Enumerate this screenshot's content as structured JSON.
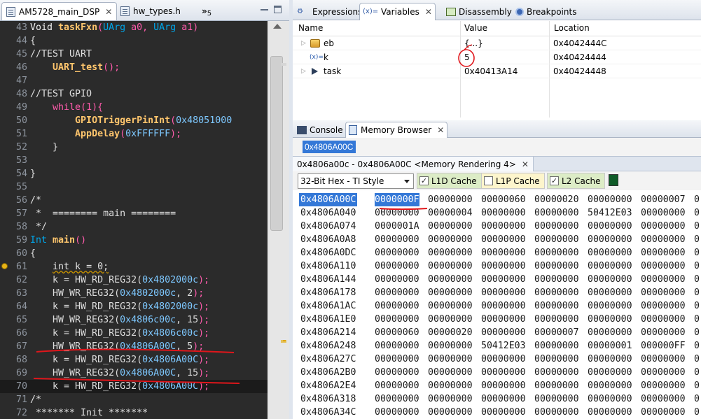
{
  "editor": {
    "tabs": [
      {
        "label": "AM5728_main_DSP",
        "active": true
      },
      {
        "label": "hw_types.h",
        "active": false
      }
    ],
    "overflow_count": "5",
    "lines": [
      {
        "no": "43",
        "segs": [
          [
            "kw2",
            "Void "
          ],
          [
            "fn",
            "taskFxn"
          ],
          [
            "punc",
            "("
          ],
          [
            "kw",
            "UArg "
          ],
          [
            "punc",
            "a0, "
          ],
          [
            "kw",
            "UArg "
          ],
          [
            "punc",
            "a1)"
          ]
        ]
      },
      {
        "no": "44",
        "segs": [
          [
            "plain",
            "{"
          ]
        ]
      },
      {
        "no": "45",
        "segs": [
          [
            "cm",
            "//TEST UART"
          ]
        ]
      },
      {
        "no": "46",
        "segs": [
          [
            "plain",
            "    "
          ],
          [
            "fn",
            "UART_test"
          ],
          [
            "punc",
            "();"
          ]
        ]
      },
      {
        "no": "47",
        "segs": []
      },
      {
        "no": "48",
        "segs": [
          [
            "cm",
            "//TEST GPIO"
          ]
        ]
      },
      {
        "no": "49",
        "segs": [
          [
            "plain",
            "    "
          ],
          [
            "mag",
            "while"
          ],
          [
            "punc",
            "(1){"
          ]
        ]
      },
      {
        "no": "50",
        "segs": [
          [
            "plain",
            "        "
          ],
          [
            "fn",
            "GPIOTriggerPinInt"
          ],
          [
            "punc",
            "("
          ],
          [
            "hex",
            "0x48051000"
          ]
        ]
      },
      {
        "no": "51",
        "segs": [
          [
            "plain",
            "        "
          ],
          [
            "fn",
            "AppDelay"
          ],
          [
            "punc",
            "("
          ],
          [
            "hex",
            "0xFFFFFF"
          ],
          [
            "punc",
            ");"
          ]
        ]
      },
      {
        "no": "52",
        "segs": [
          [
            "plain",
            "    }"
          ]
        ]
      },
      {
        "no": "53",
        "segs": []
      },
      {
        "no": "54",
        "segs": [
          [
            "plain",
            "}"
          ]
        ]
      },
      {
        "no": "55",
        "segs": []
      },
      {
        "no": "56",
        "segs": [
          [
            "cm",
            "/*"
          ]
        ]
      },
      {
        "no": "57",
        "segs": [
          [
            "cm",
            " *  ======== main ========"
          ]
        ]
      },
      {
        "no": "58",
        "segs": [
          [
            "cm",
            " */"
          ]
        ]
      },
      {
        "no": "59",
        "segs": [
          [
            "kw",
            "Int "
          ],
          [
            "fn",
            "main"
          ],
          [
            "punc",
            "()"
          ]
        ]
      },
      {
        "no": "60",
        "segs": [
          [
            "plain",
            "{"
          ]
        ]
      },
      {
        "no": "61",
        "segs": [
          [
            "plain",
            "    "
          ],
          [
            "under",
            "int k = 0;"
          ]
        ]
      },
      {
        "no": "62",
        "segs": [
          [
            "plain",
            "    k = HW_RD_REG32("
          ],
          [
            "hex",
            "0x4802000c"
          ],
          [
            "punc",
            ");"
          ]
        ]
      },
      {
        "no": "63",
        "segs": [
          [
            "plain",
            "    HW_WR_REG32("
          ],
          [
            "hex",
            "0x4802000c"
          ],
          [
            "plain",
            ", 2"
          ],
          [
            "punc",
            ");"
          ]
        ]
      },
      {
        "no": "64",
        "segs": [
          [
            "plain",
            "    k = HW_RD_REG32("
          ],
          [
            "hex",
            "0x4802000c"
          ],
          [
            "punc",
            ");"
          ]
        ]
      },
      {
        "no": "65",
        "segs": [
          [
            "plain",
            "    HW_WR_REG32("
          ],
          [
            "hex",
            "0x4806c00c"
          ],
          [
            "plain",
            ", 15"
          ],
          [
            "punc",
            ");"
          ]
        ]
      },
      {
        "no": "66",
        "segs": [
          [
            "plain",
            "    k = HW_RD_REG32("
          ],
          [
            "hex",
            "0x4806c00c"
          ],
          [
            "punc",
            ");"
          ]
        ]
      },
      {
        "no": "67",
        "segs": [
          [
            "plain",
            "    HW_WR_REG32("
          ],
          [
            "hex",
            "0x4806A00C"
          ],
          [
            "plain",
            ", 5"
          ],
          [
            "punc",
            ");"
          ]
        ]
      },
      {
        "no": "68",
        "segs": [
          [
            "plain",
            "    k = HW_RD_REG32("
          ],
          [
            "hex",
            "0x4806A00C"
          ],
          [
            "punc",
            ");"
          ]
        ]
      },
      {
        "no": "69",
        "segs": [
          [
            "plain",
            "    HW_WR_REG32("
          ],
          [
            "hex",
            "0x4806A00C"
          ],
          [
            "plain",
            ", 15"
          ],
          [
            "punc",
            ");"
          ]
        ]
      },
      {
        "no": "70",
        "segs": [
          [
            "plain",
            "    k = HW_RD_REG32("
          ],
          [
            "hex",
            "0x4806A00C"
          ],
          [
            "punc",
            ");"
          ]
        ]
      },
      {
        "no": "71",
        "segs": [
          [
            "cm",
            "/*"
          ]
        ]
      },
      {
        "no": "72",
        "segs": [
          [
            "cm",
            " ******* Init *******"
          ]
        ]
      }
    ]
  },
  "variables_view": {
    "tabs": [
      "Expressions",
      "Variables",
      "Disassembly",
      "Breakpoints"
    ],
    "active_tab": "Variables",
    "tab_prefix": "(x)=",
    "columns": [
      "Name",
      "Value",
      "Location"
    ],
    "rows": [
      {
        "name": "eb",
        "value": "{...}",
        "location": "0x4042444C"
      },
      {
        "name": "k",
        "value": "5",
        "location": "0x40424444"
      },
      {
        "name": "task",
        "value": "0x40413A14",
        "location": "0x40424448"
      }
    ]
  },
  "memory_view": {
    "tabs": [
      "Console",
      "Memory Browser"
    ],
    "active_tab": "Memory Browser",
    "address_input": "0x4806A00C",
    "rendering_tab": "0x4806a00c - 0x4806A00C <Memory Rendering 4>",
    "format": "32-Bit Hex - TI Style",
    "cache_options": [
      {
        "label": "L1D Cache",
        "checked": true,
        "color": "#dcecc6"
      },
      {
        "label": "L1P Cache",
        "checked": false,
        "color": "#fdf5cc"
      },
      {
        "label": "L2 Cache",
        "checked": true,
        "color": "#dcecc6"
      }
    ],
    "rows": [
      {
        "addr": "0x4806A00C",
        "vals": [
          "0000000F",
          "00000000",
          "00000060",
          "00000020",
          "00000000",
          "00000007",
          "0"
        ]
      },
      {
        "addr": "0x4806A040",
        "vals": [
          "00000000",
          "00000004",
          "00000000",
          "00000000",
          "50412E03",
          "00000000",
          "0"
        ]
      },
      {
        "addr": "0x4806A074",
        "vals": [
          "0000001A",
          "00000000",
          "00000000",
          "00000000",
          "00000000",
          "00000000",
          "0"
        ]
      },
      {
        "addr": "0x4806A0A8",
        "vals": [
          "00000000",
          "00000000",
          "00000000",
          "00000000",
          "00000000",
          "00000000",
          "0"
        ]
      },
      {
        "addr": "0x4806A0DC",
        "vals": [
          "00000000",
          "00000000",
          "00000000",
          "00000000",
          "00000000",
          "00000000",
          "0"
        ]
      },
      {
        "addr": "0x4806A110",
        "vals": [
          "00000000",
          "00000000",
          "00000000",
          "00000000",
          "00000000",
          "00000000",
          "0"
        ]
      },
      {
        "addr": "0x4806A144",
        "vals": [
          "00000000",
          "00000000",
          "00000000",
          "00000000",
          "00000000",
          "00000000",
          "0"
        ]
      },
      {
        "addr": "0x4806A178",
        "vals": [
          "00000000",
          "00000000",
          "00000000",
          "00000000",
          "00000000",
          "00000000",
          "0"
        ]
      },
      {
        "addr": "0x4806A1AC",
        "vals": [
          "00000000",
          "00000000",
          "00000000",
          "00000000",
          "00000000",
          "00000000",
          "0"
        ]
      },
      {
        "addr": "0x4806A1E0",
        "vals": [
          "00000000",
          "00000000",
          "00000000",
          "00000000",
          "00000000",
          "00000000",
          "0"
        ]
      },
      {
        "addr": "0x4806A214",
        "vals": [
          "00000060",
          "00000020",
          "00000000",
          "00000007",
          "00000000",
          "00000000",
          "0"
        ]
      },
      {
        "addr": "0x4806A248",
        "vals": [
          "00000000",
          "00000000",
          "50412E03",
          "00000000",
          "00000001",
          "000000FF",
          "0"
        ]
      },
      {
        "addr": "0x4806A27C",
        "vals": [
          "00000000",
          "00000000",
          "00000000",
          "00000000",
          "00000000",
          "00000000",
          "0"
        ]
      },
      {
        "addr": "0x4806A2B0",
        "vals": [
          "00000000",
          "00000000",
          "00000000",
          "00000000",
          "00000000",
          "00000000",
          "0"
        ]
      },
      {
        "addr": "0x4806A2E4",
        "vals": [
          "00000000",
          "00000000",
          "00000000",
          "00000000",
          "00000000",
          "00000000",
          "0"
        ]
      },
      {
        "addr": "0x4806A318",
        "vals": [
          "00000000",
          "00000000",
          "00000000",
          "00000000",
          "00000000",
          "00000000",
          "0"
        ]
      },
      {
        "addr": "0x4806A34C",
        "vals": [
          "00000000",
          "00000000",
          "00000000",
          "00000000",
          "00000000",
          "00000000",
          "0"
        ]
      }
    ]
  },
  "colors": {
    "editor_bg": "#2b2b2b",
    "selection": "#3478d7",
    "annotation_red": "#e0161b"
  }
}
